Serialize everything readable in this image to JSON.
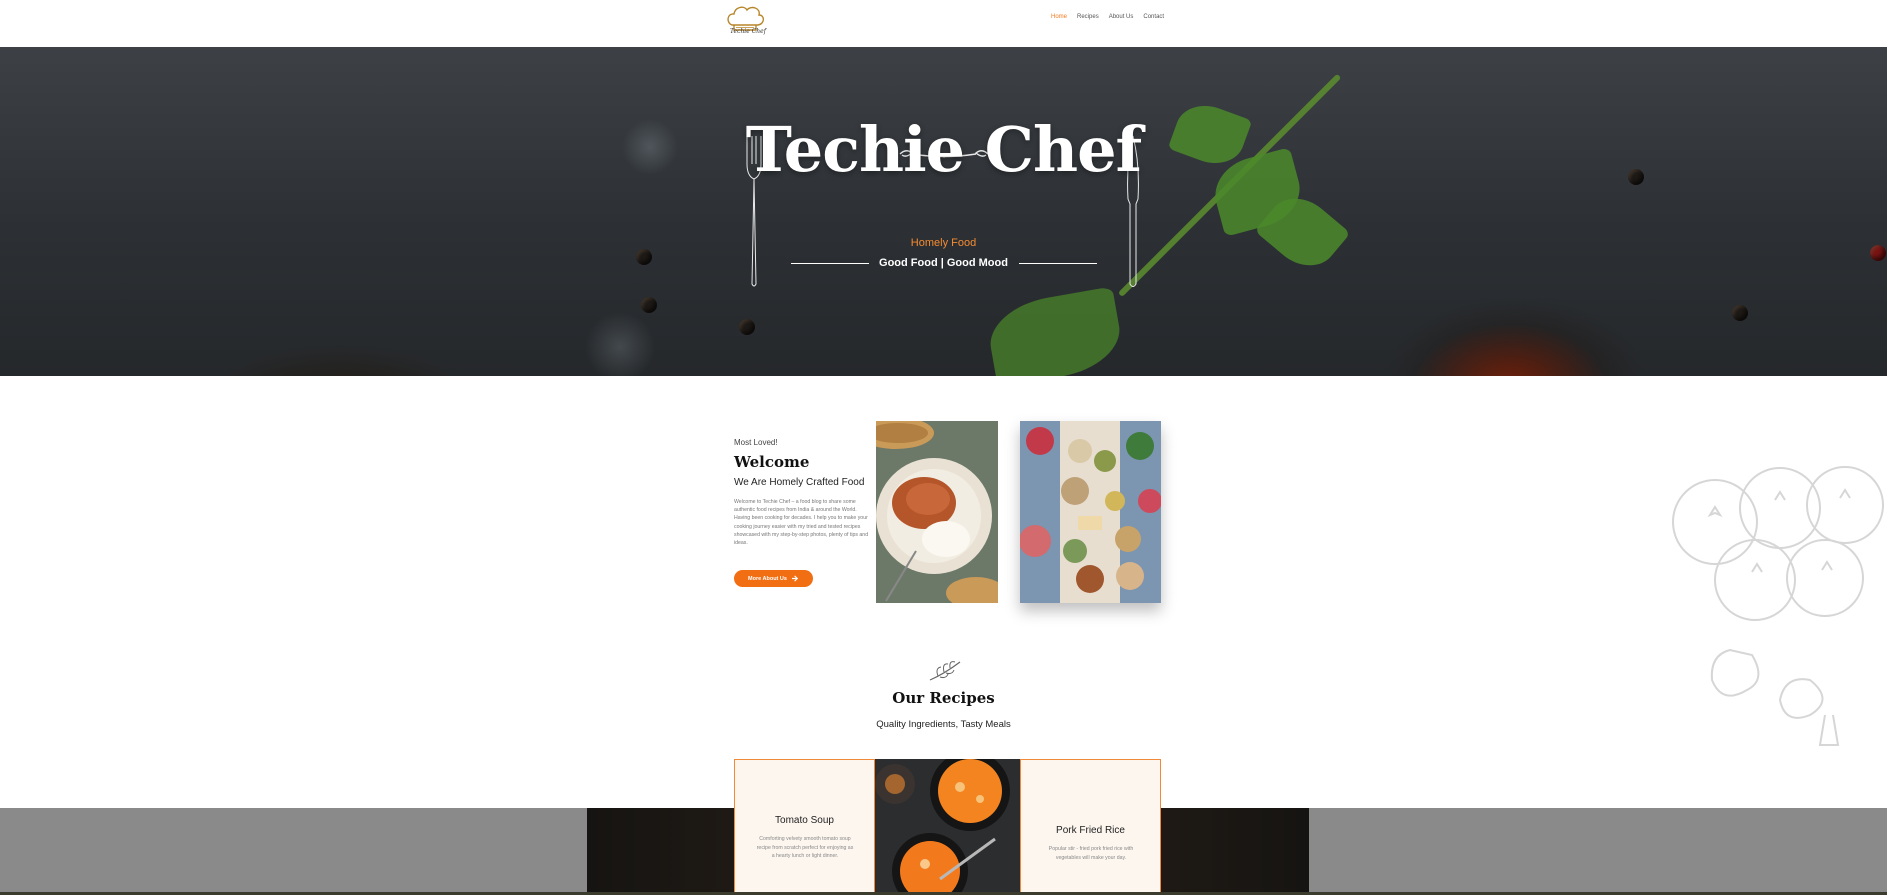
{
  "header": {
    "logo_text": "Techie Chef",
    "nav": [
      {
        "label": "Home",
        "active": true
      },
      {
        "label": "Recipes",
        "active": false
      },
      {
        "label": "About Us",
        "active": false
      },
      {
        "label": "Contact",
        "active": false
      }
    ]
  },
  "hero": {
    "title": "Techie Chef",
    "subtitle": "Homely Food",
    "tagline": "Good Food | Good Mood"
  },
  "welcome": {
    "kicker": "Most Loved!",
    "title": "Welcome",
    "subtitle": "We Are Homely Crafted Food",
    "body": "Welcome to Techie Chef – a food blog to share some authentic food recipes from India & around the World. Having been cooking for decades. I help you to make your cooking journey easier with my tried and tested recipes showcased with my step-by-step photos, plenty of tips and ideas.",
    "button_label": "More About Us"
  },
  "recipes": {
    "title": "Our Recipes",
    "subtitle": "Quality Ingredients, Tasty Meals",
    "cards": [
      {
        "title": "Tomato Soup",
        "text": "Comforting velvety smooth tomato soup recipe from scratch perfect for enjoying as a hearty lunch or light dinner."
      },
      {
        "title": "Pork Fried Rice",
        "text": "Popular stir - fried pork fried rice with vegetables will make your day."
      }
    ]
  },
  "colors": {
    "accent": "#f26e13",
    "accent_light": "#f58a32",
    "card_bg": "#fdf6ef",
    "band_gray": "#8a8a8a"
  }
}
